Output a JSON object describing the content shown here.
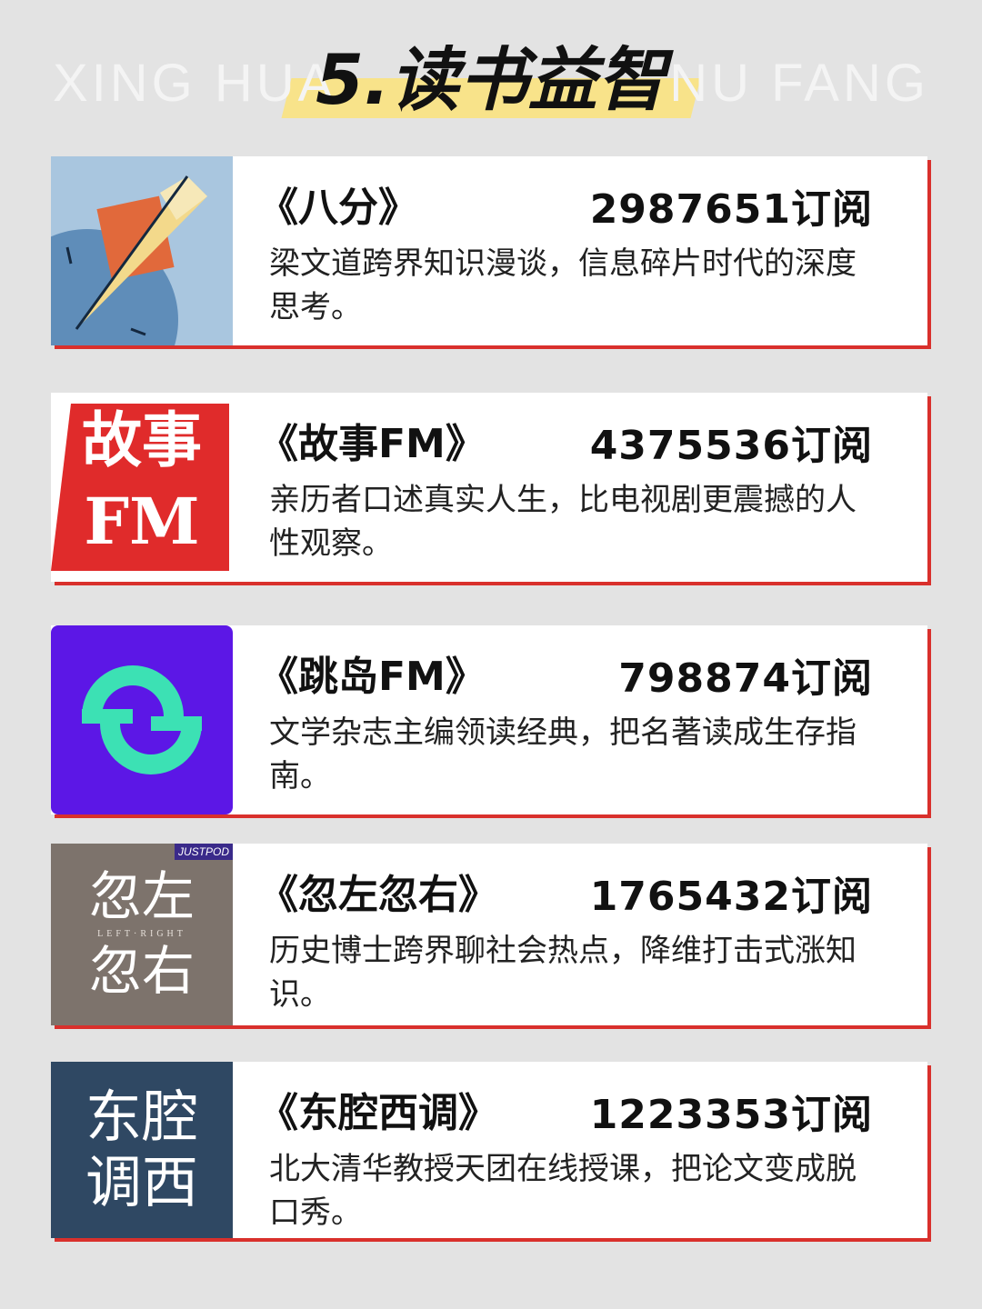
{
  "watermark": {
    "left": "XING HUA",
    "right": "NU FANG"
  },
  "title": "5.读书益智",
  "cards": [
    {
      "name": "《八分》",
      "subs": "2987651订阅",
      "desc": "梁文道跨界知识漫谈，信息碎片时代的深度思考。",
      "logo": "bafen-logo"
    },
    {
      "name": "《故事FM》",
      "subs": "4375536订阅",
      "desc": "亲历者口述真实人生，比电视剧更震撼的人性观察。",
      "logo": "gushi-fm-logo",
      "logo_text": [
        "故事",
        "FM"
      ]
    },
    {
      "name": "《跳岛FM》",
      "subs": "798874订阅",
      "desc": "文学杂志主编领读经典，把名著读成生存指南。",
      "logo": "tiaodao-fm-logo"
    },
    {
      "name": "《忽左忽右》",
      "subs": "1765432订阅",
      "desc": "历史博士跨界聊社会热点，降维打击式涨知识。",
      "logo": "huzuohuyou-logo",
      "logo_text": [
        "忽左",
        "忽右"
      ],
      "logo_badge": "JUSTPOD",
      "logo_sub": "LEFT·RIGHT"
    },
    {
      "name": "《东腔西调》",
      "subs": "1223353订阅",
      "desc": "北大清华教授天团在线授课，把论文变成脱口秀。",
      "logo": "dongqiang-xidiao-logo",
      "logo_text": [
        "东腔",
        "调西"
      ]
    }
  ]
}
